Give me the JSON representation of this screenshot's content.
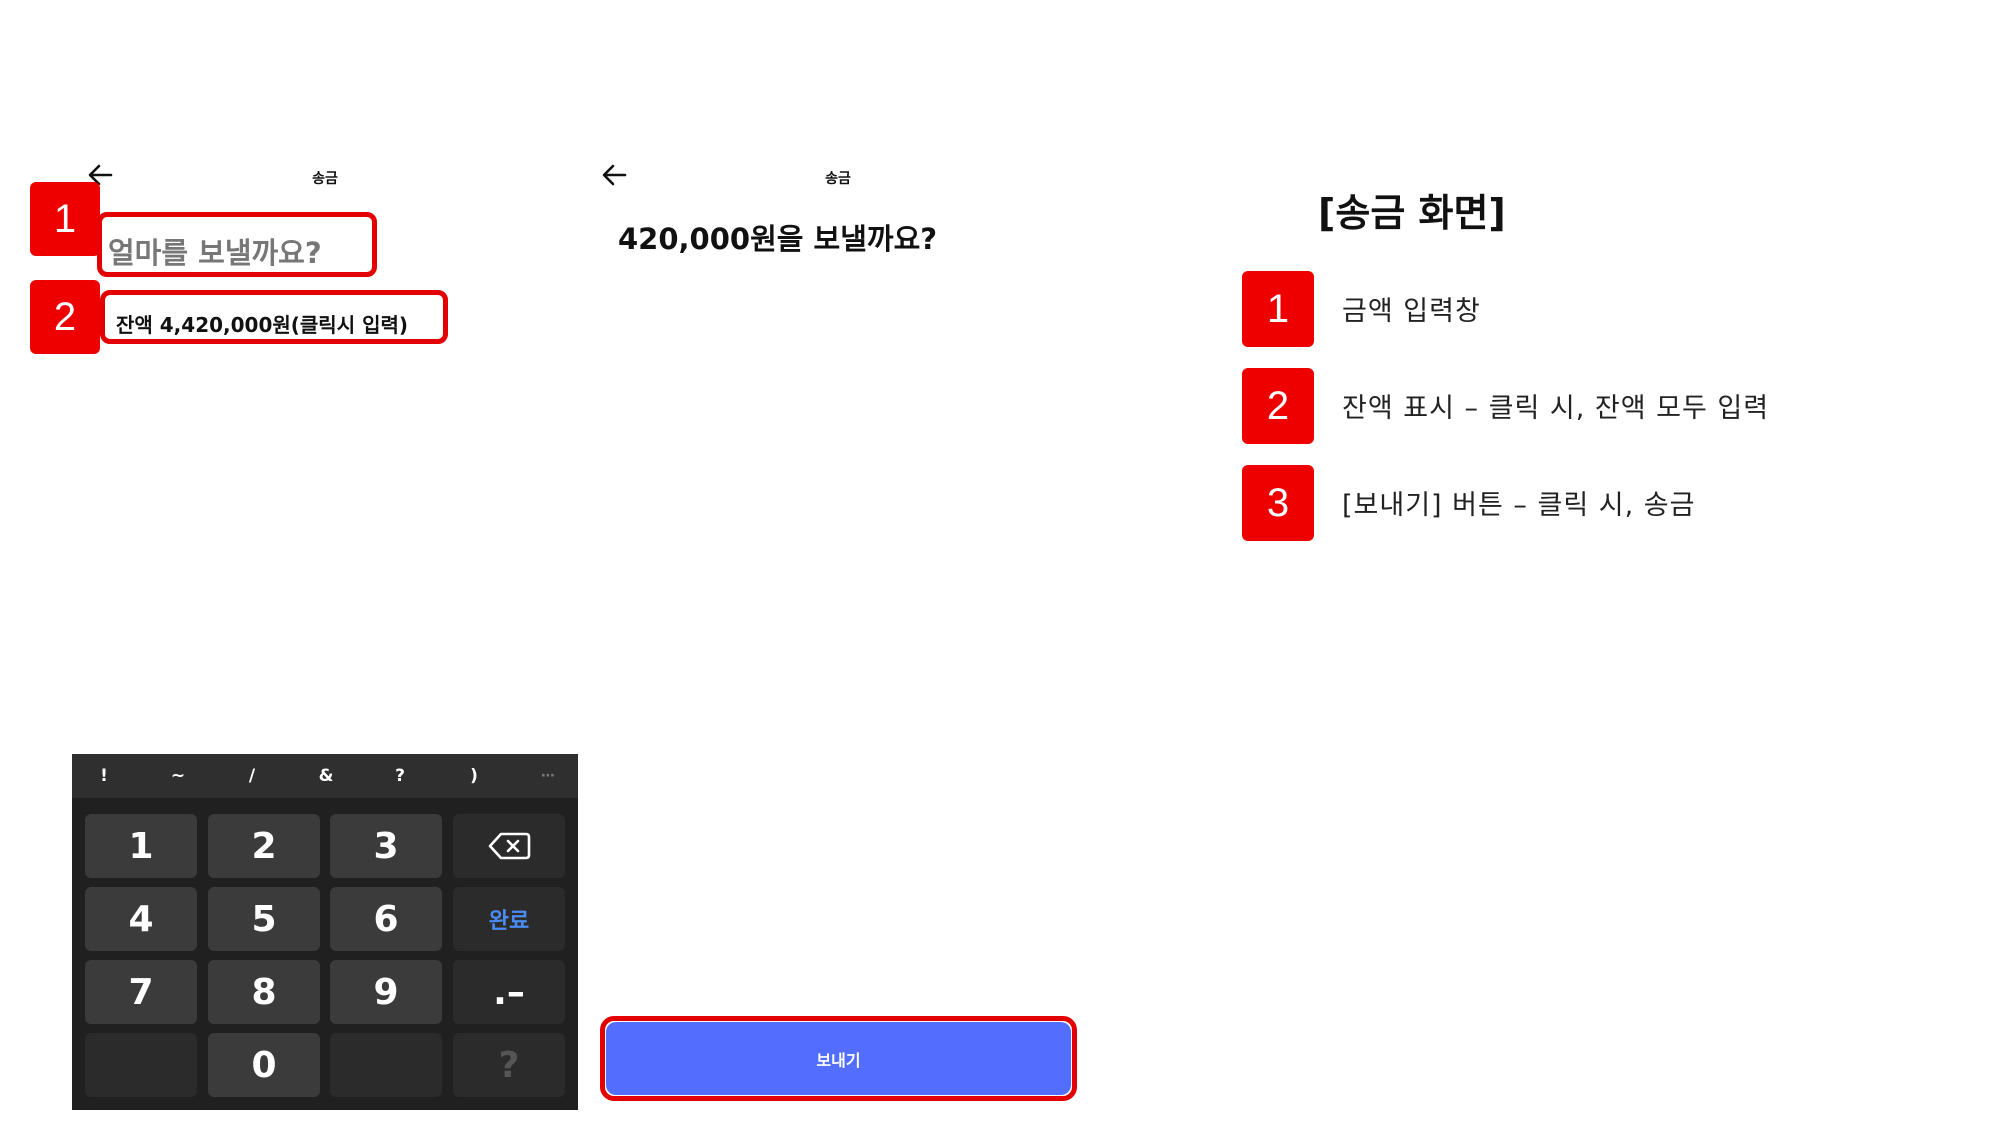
{
  "screen_before": {
    "title": "송금",
    "amount_placeholder": "얼마를 보낼까요?",
    "balance_text": "잔액 4,420,000원(클릭시 입력)"
  },
  "screen_after": {
    "title": "송금",
    "amount_text": "420,000원을 보낼까요?",
    "send_button": "보내기"
  },
  "keyboard": {
    "symbols": [
      "!",
      "~",
      "/",
      "&",
      "?",
      ")",
      "⋯"
    ],
    "keys": [
      "1",
      "2",
      "3",
      "4",
      "5",
      "6",
      "7",
      "8",
      "9",
      "0"
    ],
    "done_label": "완료",
    "dot_dash_label": ".–",
    "question_label": "?"
  },
  "badges": [
    "1",
    "2",
    "3"
  ],
  "legend": {
    "title": "[송금 화면]",
    "items": [
      {
        "number": "1",
        "text": "금액 입력창"
      },
      {
        "number": "2",
        "text": "잔액 표시 – 클릭 시, 잔액 모두 입력"
      },
      {
        "number": "3",
        "text": "[보내기] 버튼 – 클릭 시, 송금"
      }
    ]
  },
  "colors": {
    "annotation_red": "#ee0000",
    "send_button": "#536dfe",
    "keyboard_bg": "#202020",
    "done_key_text": "#4a8cf2"
  }
}
